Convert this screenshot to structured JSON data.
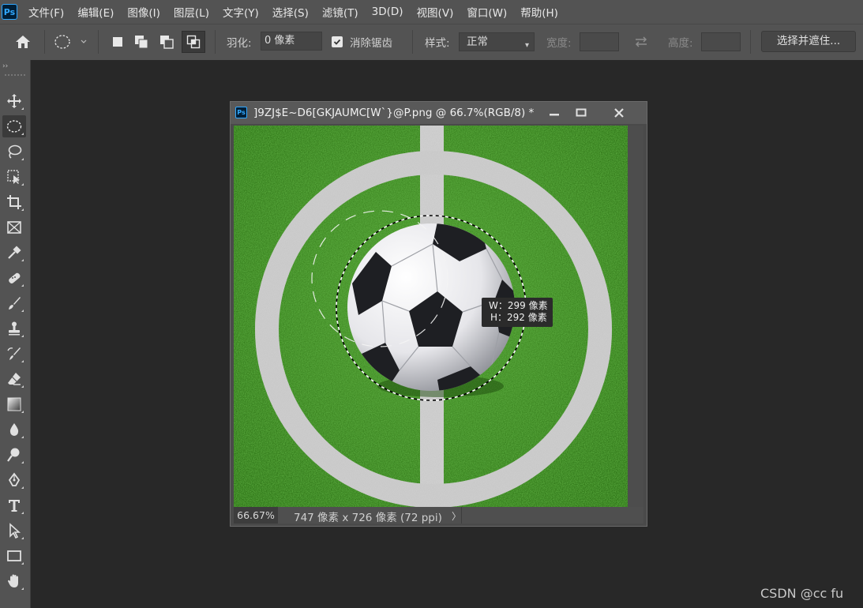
{
  "app": {
    "logo": "Ps"
  },
  "menu": [
    "文件(F)",
    "编辑(E)",
    "图像(I)",
    "图层(L)",
    "文字(Y)",
    "选择(S)",
    "滤镜(T)",
    "3D(D)",
    "视图(V)",
    "窗口(W)",
    "帮助(H)"
  ],
  "options": {
    "feather_label": "羽化:",
    "feather_value": "0 像素",
    "antialias_label": "消除锯齿",
    "antialias_checked": true,
    "style_label": "样式:",
    "style_value": "正常",
    "width_label": "宽度:",
    "height_label": "高度:",
    "select_mask_button": "选择并遮住..."
  },
  "tools": [
    "move-icon",
    "elliptical-marquee-icon",
    "lasso-icon",
    "object-selection-icon",
    "crop-icon",
    "frame-icon",
    "eyedropper-icon",
    "healing-brush-icon",
    "brush-icon",
    "clone-stamp-icon",
    "history-brush-icon",
    "eraser-icon",
    "gradient-icon",
    "blur-icon",
    "dodge-icon",
    "pen-icon",
    "type-icon",
    "path-selection-icon",
    "rectangle-icon",
    "hand-icon"
  ],
  "active_tool": "elliptical-marquee-icon",
  "document": {
    "title": "]9ZJ$E~D6[GKJAUMC[W`}@P.png @ 66.7%(RGB/8) *",
    "zoom": "66.67%",
    "size_info": "747 像素 x 726 像素 (72 ppi)",
    "status_arrow": "〉"
  },
  "tooltip": {
    "w": "W：299 像素",
    "h": "H：292 像素"
  },
  "colors": {
    "grass": "#3a8a24",
    "line": "#cfcfcf",
    "panel": "#535353",
    "background": "#282828",
    "accent": "#31a8ff"
  },
  "watermark": "CSDN @cc fu"
}
